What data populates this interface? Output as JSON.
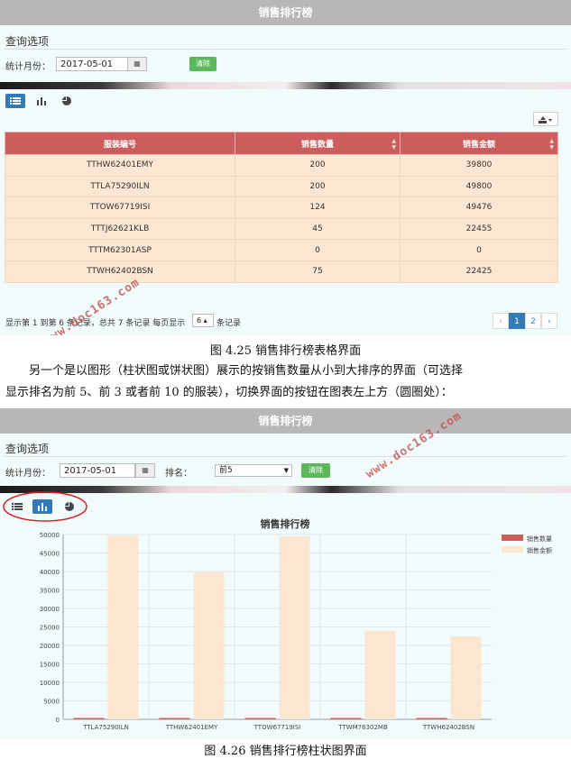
{
  "fig1": {
    "title": "销售排行榜",
    "query_heading": "查询选项",
    "month_label": "统计月份：",
    "month_value": "2017-05-01",
    "clear_label": "清除",
    "columns": [
      "服装编号",
      "销售数量",
      "销售金额"
    ],
    "rows": [
      [
        "TTHW62401EMY",
        "200",
        "39800"
      ],
      [
        "TTLA75290ILN",
        "200",
        "49800"
      ],
      [
        "TTOW67719ISI",
        "124",
        "49476"
      ],
      [
        "TTTJ62621KLB",
        "45",
        "22455"
      ],
      [
        "TTTM62301ASP",
        "0",
        "0"
      ],
      [
        "TTWH62402BSN",
        "75",
        "22425"
      ]
    ],
    "footer_pre": "显示第 1 到第 6 条记录，总共 7 条记录 每页显示",
    "page_size": "6",
    "footer_post": "条记录",
    "pages": [
      "‹",
      "1",
      "2",
      "›"
    ]
  },
  "caption1": "图 4.25 销售排行榜表格界面",
  "para_line1": "另一个是以图形（柱状图或饼状图）展示的按销售数量从小到大排序的界面（可选择",
  "para_line2": "显示排名为前 5、前 3 或者前 10 的服装），切换界面的按钮在图表左上方（圆圈处）：",
  "fig2": {
    "title": "销售排行榜",
    "query_heading": "查询选项",
    "month_label": "统计月份：",
    "month_value": "2017-05-01",
    "rank_label": "排名：",
    "rank_value": "前5",
    "clear_label": "清除"
  },
  "caption2": "图 4.26 销售排行榜柱状图界面",
  "watermark": "www.doc163.com",
  "colors": {
    "header_red": "#cd5c5c",
    "row_peach": "#fbe6d1",
    "active_blue": "#337ab7",
    "clear_green": "#5cb85c"
  },
  "chart_data": {
    "type": "bar",
    "title": "销售排行榜",
    "categories": [
      "TTLA75290ILN",
      "TTHW62401EMY",
      "TTOW67719ISI",
      "TTWM76302MB",
      "TTWH62402BSN"
    ],
    "series": [
      {
        "name": "销售数量",
        "values": [
          200,
          200,
          124,
          100,
          75
        ],
        "color": "#cd5c5c"
      },
      {
        "name": "销售金额",
        "values": [
          49800,
          39800,
          49476,
          24000,
          22425
        ],
        "color": "#fbe6d1"
      }
    ],
    "yticks": [
      "0",
      "5000",
      "10000",
      "15000",
      "20000",
      "25000",
      "30000",
      "35000",
      "40000",
      "45000",
      "50000"
    ],
    "ylim": [
      0,
      50000
    ],
    "legend": "top-right",
    "grid": true
  }
}
